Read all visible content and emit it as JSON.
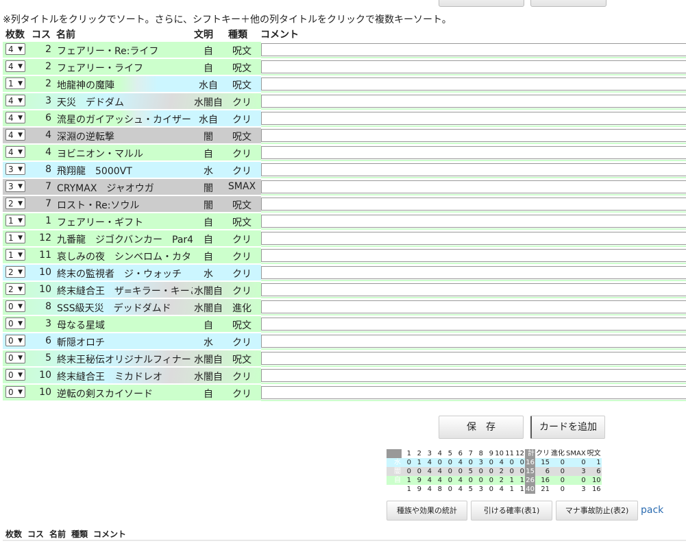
{
  "note": "※列タイトルをクリックでソート。さらに、シフトキー＋他の列タイトルをクリックで複数キーソート。",
  "headers": {
    "qty": "枚数",
    "cost": "コス",
    "name": "名前",
    "civ": "文明",
    "type": "種類",
    "comment": "コメント"
  },
  "rows": [
    {
      "qty": "4",
      "cost": "2",
      "name": "フェアリー・Re:ライフ",
      "civ": "自",
      "type": "呪文",
      "color": "green"
    },
    {
      "qty": "4",
      "cost": "2",
      "name": "フェアリー・ライフ",
      "civ": "自",
      "type": "呪文",
      "color": "green"
    },
    {
      "qty": "1",
      "cost": "2",
      "name": "地龍神の魔陣",
      "civ": "水自",
      "type": "呪文",
      "color": "gb"
    },
    {
      "qty": "4",
      "cost": "3",
      "name": "天災　デドダム",
      "civ": "水闇自",
      "type": "クリ",
      "color": "gbg"
    },
    {
      "qty": "4",
      "cost": "6",
      "name": "流星のガイアッシュ・カイザー",
      "civ": "水自",
      "type": "クリ",
      "color": "gb"
    },
    {
      "qty": "4",
      "cost": "4",
      "name": "深淵の逆転撃",
      "civ": "闇",
      "type": "呪文",
      "color": "gray"
    },
    {
      "qty": "4",
      "cost": "4",
      "name": "ヨビニオン・マルル",
      "civ": "自",
      "type": "クリ",
      "color": "green"
    },
    {
      "qty": "3",
      "cost": "8",
      "name": "飛翔龍　5000VT",
      "civ": "水",
      "type": "クリ",
      "color": "blue"
    },
    {
      "qty": "3",
      "cost": "7",
      "name": "CRYMAX　ジャオウガ",
      "civ": "闇",
      "type": "SMAX",
      "color": "gray"
    },
    {
      "qty": "2",
      "cost": "7",
      "name": "ロスト・Re:ソウル",
      "civ": "闇",
      "type": "呪文",
      "color": "gray"
    },
    {
      "qty": "1",
      "cost": "1",
      "name": "フェアリー・ギフト",
      "civ": "自",
      "type": "呪文",
      "color": "green"
    },
    {
      "qty": "1",
      "cost": "12",
      "name": "九番龍　ジゴクバンカー　Par4",
      "civ": "自",
      "type": "クリ",
      "color": "green"
    },
    {
      "qty": "1",
      "cost": "11",
      "name": "哀しみの夜　シンベロム・カタ",
      "civ": "自",
      "type": "クリ",
      "color": "green"
    },
    {
      "qty": "2",
      "cost": "10",
      "name": "終末の監視者　ジ・ウォッチ",
      "civ": "水",
      "type": "クリ",
      "color": "blue"
    },
    {
      "qty": "2",
      "cost": "10",
      "name": "終末縫合王　ザ=キラー・キーこ",
      "civ": "水闇自",
      "type": "クリ",
      "color": "gbg"
    },
    {
      "qty": "0",
      "cost": "8",
      "name": "SSS級天災　デッドダムド",
      "civ": "水闇自",
      "type": "進化",
      "color": "gbg"
    },
    {
      "qty": "0",
      "cost": "3",
      "name": "母なる星域",
      "civ": "自",
      "type": "呪文",
      "color": "green"
    },
    {
      "qty": "0",
      "cost": "6",
      "name": "斬隠オロチ",
      "civ": "水",
      "type": "クリ",
      "color": "blue"
    },
    {
      "qty": "0",
      "cost": "5",
      "name": "終末王秘伝オリジナルフィナー",
      "civ": "水闇自",
      "type": "呪文",
      "color": "gbg"
    },
    {
      "qty": "0",
      "cost": "10",
      "name": "終末縫合王　ミカドレオ",
      "civ": "水闇自",
      "type": "クリ",
      "color": "gbg"
    },
    {
      "qty": "0",
      "cost": "10",
      "name": "逆転の剣スカイソード",
      "civ": "自",
      "type": "クリ",
      "color": "green"
    }
  ],
  "buttons": {
    "save": "保　存",
    "add_card": "カードを追加",
    "stats": "種族や効果の統計",
    "draw_prob": "引ける確率(表1)",
    "mana_prevent": "マナ事故防止(表2)",
    "pack": "pack"
  },
  "stats": {
    "header": [
      "",
      "1",
      "2",
      "3",
      "4",
      "5",
      "6",
      "7",
      "8",
      "9",
      "10",
      "11",
      "12",
      "計",
      "クリ",
      "進化",
      "SMAX",
      "呪文"
    ],
    "rows": [
      {
        "label": "水",
        "values": [
          "0",
          "1",
          "4",
          "0",
          "0",
          "4",
          "0",
          "3",
          "0",
          "4",
          "0",
          "0",
          "16",
          "15",
          "0",
          "0",
          "1"
        ],
        "class": "r-water"
      },
      {
        "label": "闇",
        "values": [
          "0",
          "0",
          "4",
          "4",
          "0",
          "0",
          "5",
          "0",
          "0",
          "2",
          "0",
          "0",
          "15",
          "6",
          "0",
          "3",
          "6"
        ],
        "class": "r-dark"
      },
      {
        "label": "自",
        "values": [
          "1",
          "9",
          "4",
          "4",
          "0",
          "4",
          "0",
          "0",
          "0",
          "2",
          "1",
          "1",
          "26",
          "16",
          "0",
          "0",
          "10"
        ],
        "class": "r-light"
      },
      {
        "label": "計",
        "values": [
          "1",
          "9",
          "4",
          "8",
          "0",
          "4",
          "5",
          "3",
          "0",
          "4",
          "1",
          "1",
          "40",
          "21",
          "0",
          "3",
          "16"
        ],
        "class": "r-total"
      }
    ]
  },
  "bottom_headers": {
    "qty": "枚数",
    "cost": "コス",
    "name": "名前",
    "type": "種類",
    "comment": "コメント"
  }
}
